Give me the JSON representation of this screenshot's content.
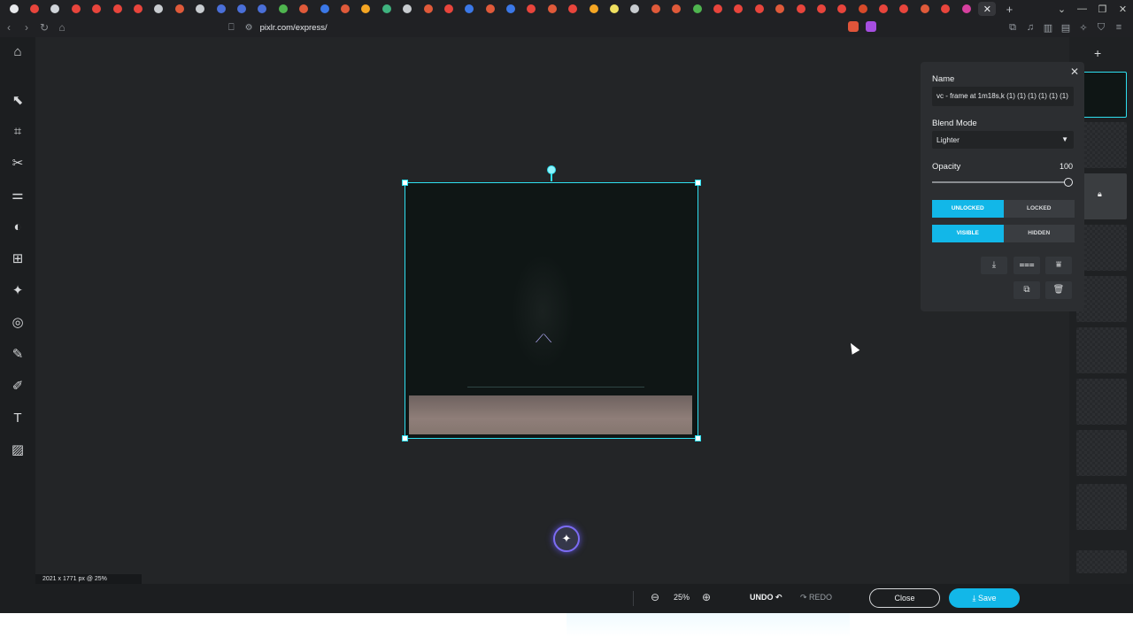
{
  "browser": {
    "tab_favicon_colors": [
      "#e8eaed",
      "#e8453c",
      "#d0d4d9",
      "#e8453c",
      "#e8453c",
      "#e8453c",
      "#e8453c",
      "#c8ccd0",
      "#e05a3a",
      "#c8ccd0",
      "#4a6fd8",
      "#4a6fd8",
      "#4a6fd8",
      "#4fb54f",
      "#e05a3a",
      "#3b78e7",
      "#e05a3a",
      "#f5a623",
      "#3fb37f",
      "#c8ccd0",
      "#e05a3a",
      "#e8453c",
      "#3b78e7",
      "#e05a3a",
      "#3b78e7",
      "#e8453c",
      "#e05a3a",
      "#e8453c",
      "#f5a623",
      "#f0e060",
      "#c8ccd0",
      "#e05a3a",
      "#e05a3a",
      "#4fb54f",
      "#e8453c",
      "#e8453c",
      "#e8453c",
      "#e05a3a",
      "#e8453c",
      "#e8453c",
      "#e8453c",
      "#d84a2a",
      "#e8453c",
      "#e8453c",
      "#e05a3a",
      "#e8453c",
      "#d6409f"
    ],
    "active_tab_close": "✕",
    "new_tab": "+",
    "url": "pixlr.com/express/"
  },
  "tools": [
    {
      "name": "home",
      "glyph": "⌂"
    },
    {
      "name": "arrange",
      "glyph": "⬉"
    },
    {
      "name": "crop",
      "glyph": "⌗"
    },
    {
      "name": "cutout",
      "glyph": "✂"
    },
    {
      "name": "adjust",
      "glyph": "⚌"
    },
    {
      "name": "filter",
      "glyph": "◐"
    },
    {
      "name": "effect",
      "glyph": "⊞"
    },
    {
      "name": "ai",
      "glyph": "✦"
    },
    {
      "name": "liquify",
      "glyph": "◎"
    },
    {
      "name": "retouch",
      "glyph": "✎"
    },
    {
      "name": "draw",
      "glyph": "✐"
    },
    {
      "name": "text",
      "glyph": "T"
    },
    {
      "name": "pattern",
      "glyph": "▨"
    }
  ],
  "canvas": {
    "dimensions_label": "2021 x 1771 px @ 25%"
  },
  "properties": {
    "name_label": "Name",
    "name_value": "vc - frame at 1m18s,k (1) (1) (1) (1) (1) (1)",
    "blend_label": "Blend Mode",
    "blend_value": "Lighter",
    "opacity_label": "Opacity",
    "opacity_value": "100",
    "opacity_fraction": 1.0,
    "unlocked_label": "UNLOCKED",
    "locked_label": "LOCKED",
    "visible_label": "VISIBLE",
    "hidden_label": "HIDDEN"
  },
  "bottom": {
    "zoom": "25%",
    "undo": "UNDO",
    "redo": "REDO",
    "close": "Close",
    "save": "Save"
  },
  "colors": {
    "accent": "#12b7e8",
    "selection": "#2ee0f0"
  }
}
